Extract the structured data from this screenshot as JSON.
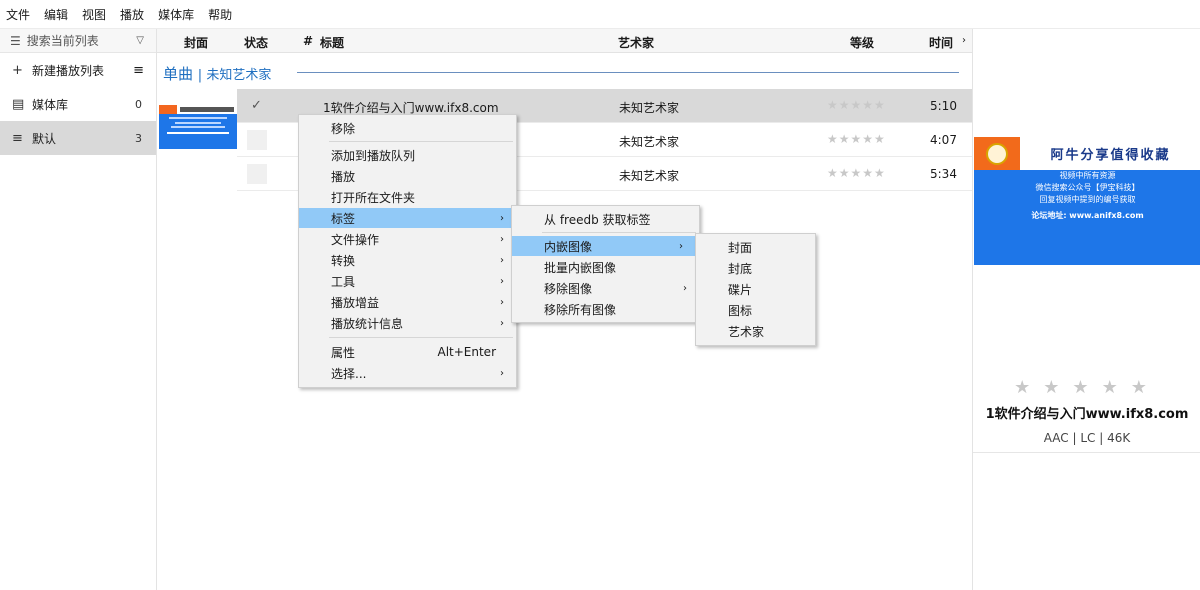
{
  "menubar": [
    "文件",
    "编辑",
    "视图",
    "播放",
    "媒体库",
    "帮助"
  ],
  "sidebar": {
    "search_placeholder": "搜索当前列表",
    "items": [
      {
        "label": "新建播放列表",
        "icon": "plus-icon",
        "right": "≡"
      },
      {
        "label": "媒体库",
        "icon": "library-icon",
        "count": "0"
      },
      {
        "label": "默认",
        "icon": "list-icon",
        "count": "3"
      }
    ]
  },
  "columns": {
    "cover": "封面",
    "status": "状态",
    "num": "#",
    "title": "标题",
    "artist": "艺术家",
    "rating": "等级",
    "time": "时间"
  },
  "group": {
    "title": "单曲",
    "subtitle": "未知艺术家"
  },
  "tracks": [
    {
      "title": "1软件介绍与入门www.ifx8.com",
      "artist": "未知艺术家",
      "time": "5:10",
      "status": "✓",
      "rating": 0
    },
    {
      "title": "",
      "artist": "未知艺术家",
      "time": "4:07",
      "status": "",
      "rating": 0
    },
    {
      "title": "",
      "artist": "未知艺术家",
      "time": "5:34",
      "status": "",
      "rating": 0
    }
  ],
  "context_menu": {
    "items": [
      "移除",
      "添加到播放队列",
      "播放",
      "打开所在文件夹",
      "标签",
      "文件操作",
      "转换",
      "工具",
      "播放增益",
      "播放统计信息",
      "属性",
      "选择..."
    ],
    "shortcut_properties": "Alt+Enter"
  },
  "tag_submenu": {
    "items": [
      "从 freedb 获取标签",
      "内嵌图像",
      "批量内嵌图像",
      "移除图像",
      "移除所有图像"
    ]
  },
  "image_submenu": {
    "items": [
      "封面",
      "封底",
      "碟片",
      "图标",
      "艺术家"
    ]
  },
  "now_playing": {
    "cover_title": "阿牛分享值得收藏",
    "cover_lines": [
      "视频中所有资源",
      "微信搜索公众号【伊宝科技】",
      "回复视频中提到的编号获取"
    ],
    "cover_url": "论坛地址: www.anifx8.com",
    "title": "1软件介绍与入门www.ifx8.com",
    "meta": "AAC | LC | 46K",
    "rating": 0
  },
  "colors": {
    "accent": "#1f6fc0",
    "highlight": "#91c9f7",
    "cover_blue": "#1e76e8",
    "cover_orange": "#f26a1b"
  }
}
